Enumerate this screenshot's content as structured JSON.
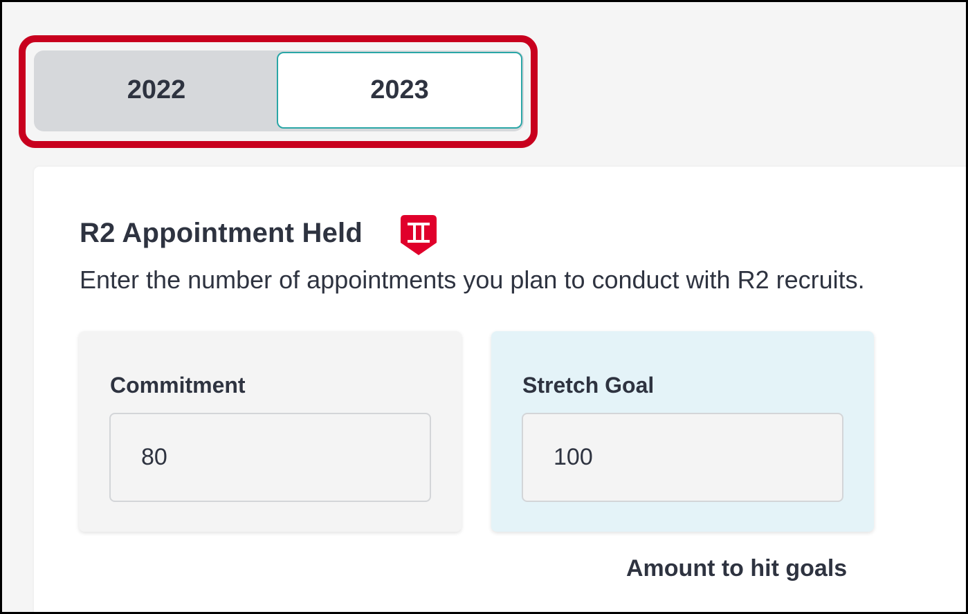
{
  "year_toggle": {
    "tabs": [
      {
        "label": "2022",
        "selected": false
      },
      {
        "label": "2023",
        "selected": true
      }
    ]
  },
  "section": {
    "title": "R2 Appointment Held",
    "icon": "roman-two-badge-icon",
    "description": "Enter the number of appointments you plan to conduct with R2 recruits."
  },
  "commitment": {
    "label": "Commitment",
    "value": "80"
  },
  "stretch_goal": {
    "label": "Stretch Goal",
    "value": "100"
  },
  "amount_label": "Amount to hit goals",
  "colors": {
    "highlight": "#c8001e",
    "selected_tab_border": "#2aa6a6",
    "badge": "#e0002b",
    "text": "#2e3340",
    "stretch_bg": "#e4f3f8"
  }
}
